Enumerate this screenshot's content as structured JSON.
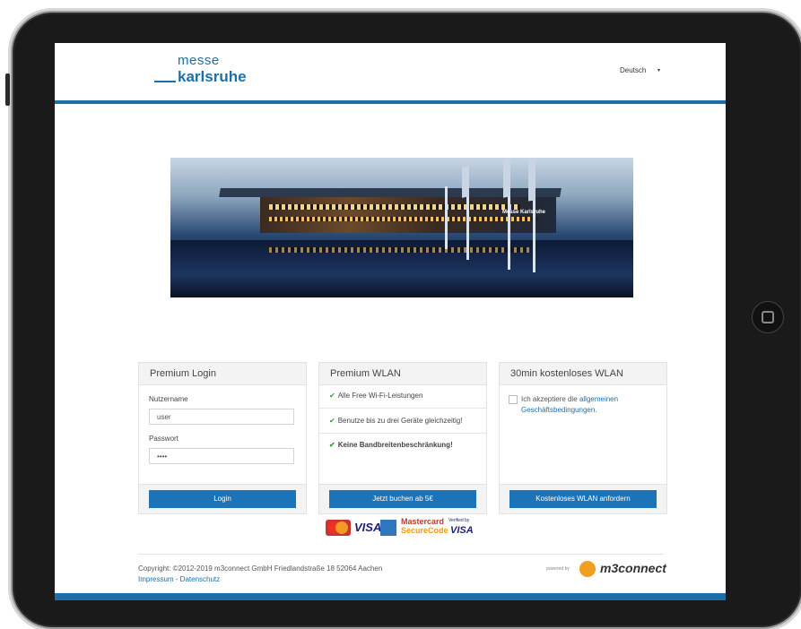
{
  "header": {
    "logo_top": "messe",
    "logo_bottom": "karlsruhe",
    "language": "Deutsch",
    "language_caret": "▾"
  },
  "hero": {
    "sign_text": "Messe Karlsruhe"
  },
  "panels": {
    "login": {
      "title": "Premium Login",
      "username_label": "Nutzername",
      "username_value": "user",
      "password_label": "Passwort",
      "password_value": "••••",
      "button": "Login"
    },
    "premium": {
      "title": "Premium WLAN",
      "features": [
        "Alle Free Wi-Fi-Leistungen",
        "Benutze bis zu drei Geräte gleichzeitig!",
        "Keine Bandbreitenbeschränkung!"
      ],
      "check": "✔",
      "button": "Jetzt buchen ab 5€"
    },
    "free": {
      "title": "30min kostenloses WLAN",
      "terms_prefix": "Ich akzeptiere die ",
      "terms_link": "allgemeinen Geschäftsbedingungen",
      "terms_suffix": ".",
      "button": "Kostenloses WLAN anfordern"
    }
  },
  "payments": {
    "visa": "VISA",
    "mc_line1": "Mastercard",
    "mc_line2": "SecureCode",
    "vbv_line1": "Verified by",
    "vbv_line2": "VISA"
  },
  "footer": {
    "copyright": "Copyright: ©2012-2019 m3connect GmbH Friedlandstraße 18 52064 Aachen",
    "impressum": "Impressum",
    "separator": " - ",
    "datenschutz": "Datenschutz",
    "powered_by": "powered by",
    "brand": "m3connect"
  }
}
